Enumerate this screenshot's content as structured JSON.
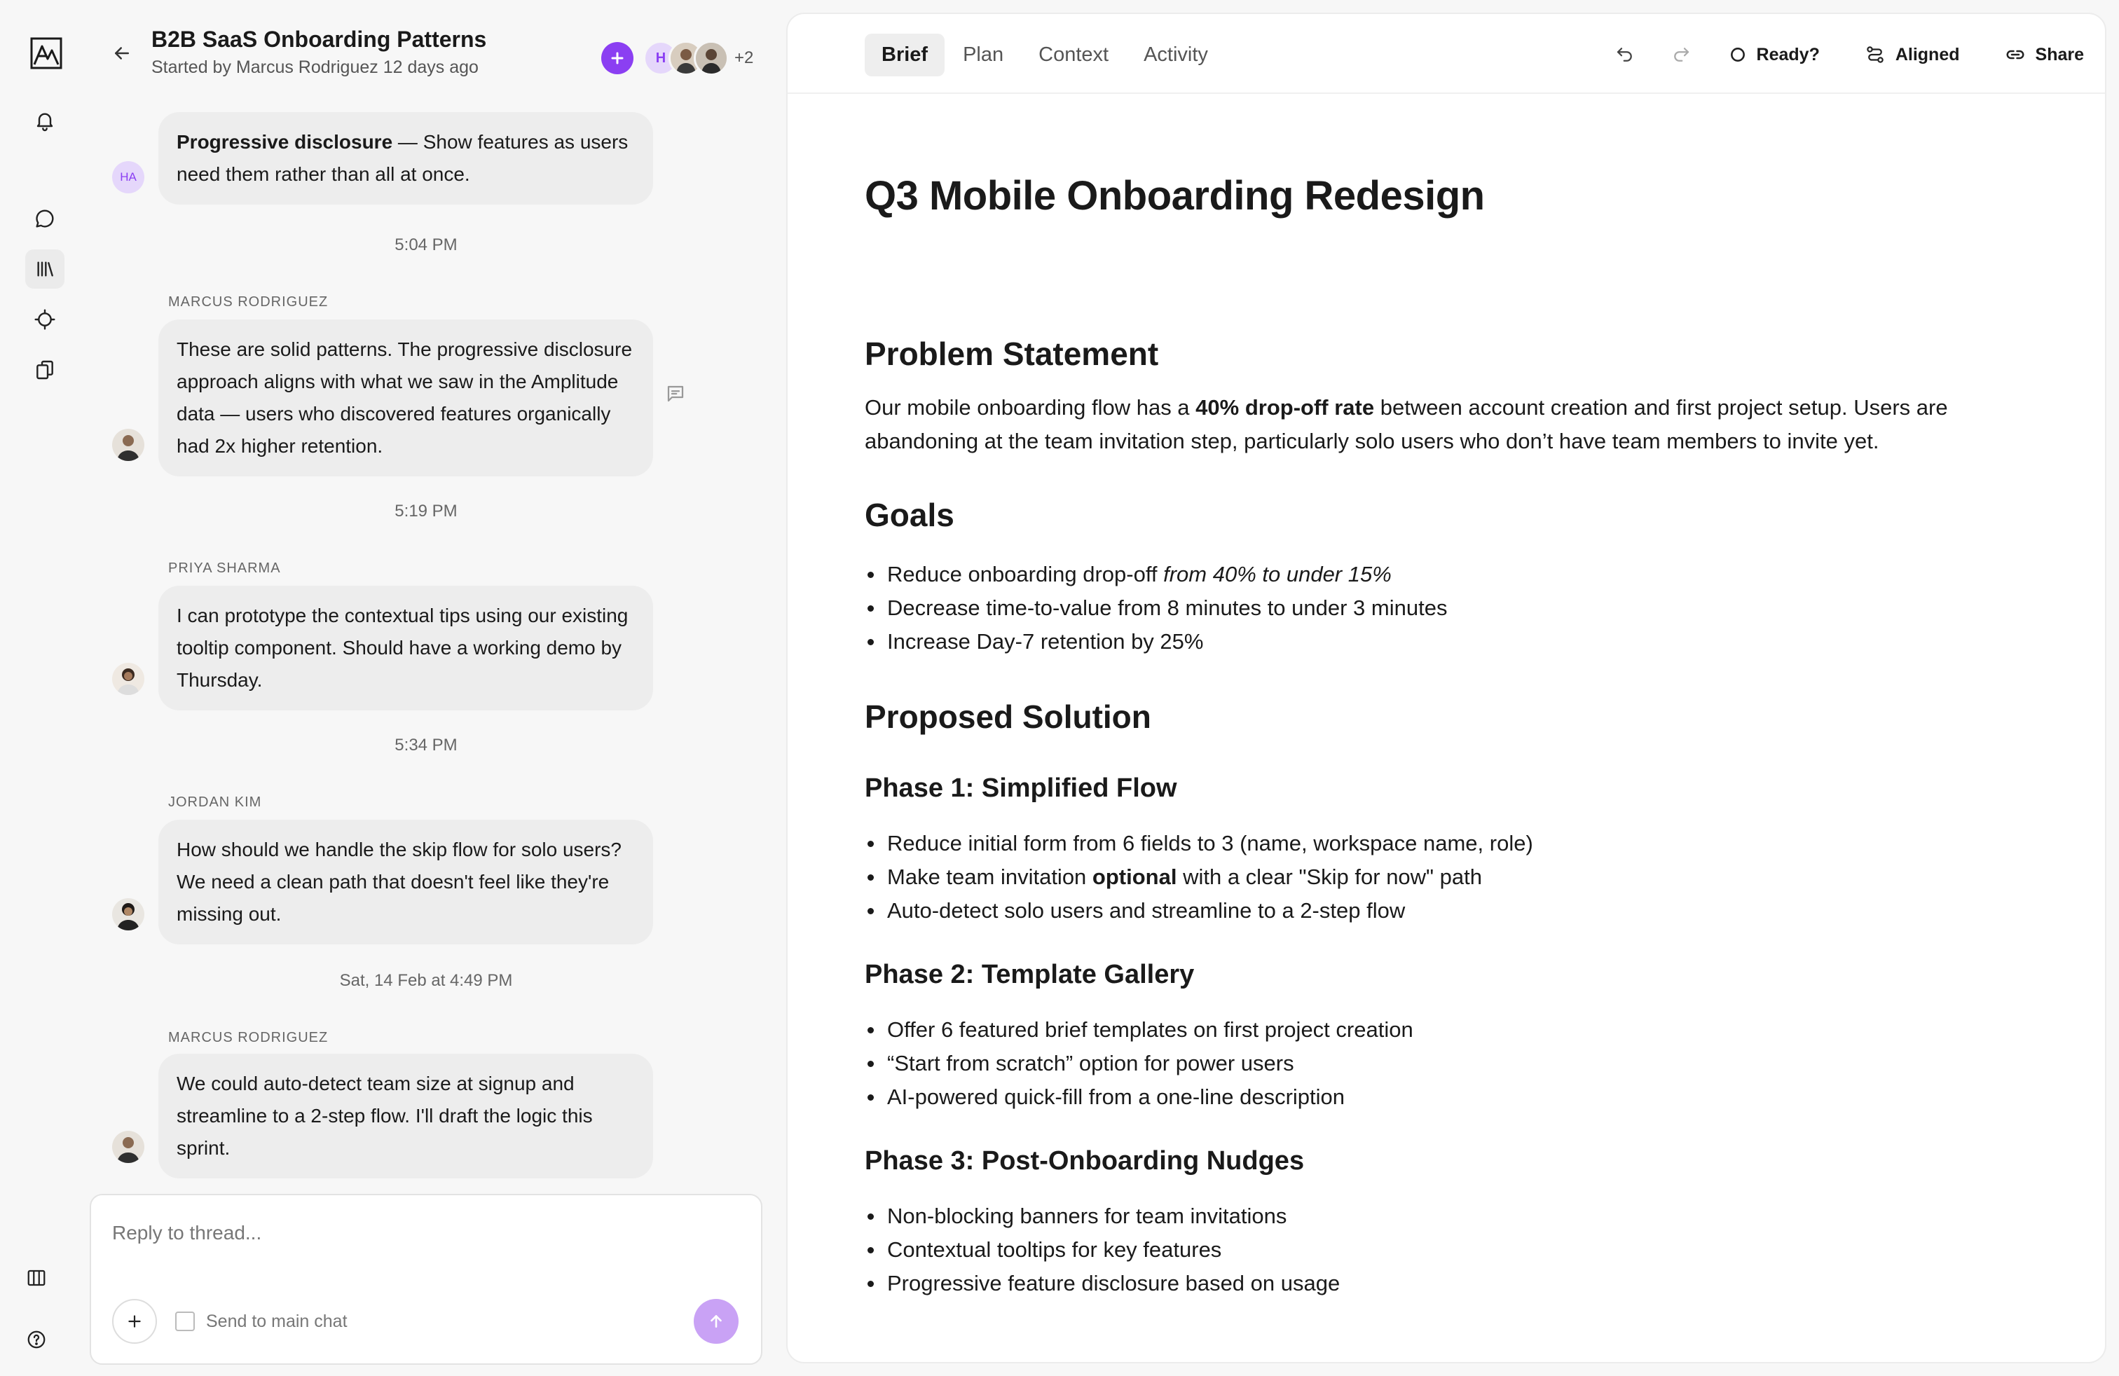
{
  "thread": {
    "title": "B2B SaaS Onboarding Patterns",
    "subtitle": "Started by Marcus Rodriguez 12 days ago",
    "avatar_initial": "H",
    "extra_members": "+2",
    "messages": [
      {
        "avatar_initials": "HA",
        "text_bold": "Progressive disclosure",
        "text_rest": " — Show features as users need them rather than all at once."
      },
      {
        "time": "5:04 PM",
        "author": "MARCUS RODRIGUEZ",
        "text": "These are solid patterns. The progressive disclosure approach aligns with what we saw in the Amplitude data — users who discovered features organically had 2x higher retention."
      },
      {
        "time": "5:19 PM",
        "author": "PRIYA SHARMA",
        "text": "I can prototype the contextual tips using our existing tooltip component. Should have a working demo by Thursday."
      },
      {
        "time": "5:34 PM",
        "author": "JORDAN KIM",
        "text": "How should we handle the skip flow for solo users? We need a clean path that doesn't feel like they're missing out."
      },
      {
        "time": "Sat, 14 Feb at 4:49 PM",
        "author": "MARCUS RODRIGUEZ",
        "text": "We could auto-detect team size at signup and streamline to a 2-step flow. I'll draft the logic this sprint."
      }
    ],
    "composer": {
      "placeholder": "Reply to thread...",
      "send_to_main_label": "Send to main chat"
    }
  },
  "brief": {
    "tabs": [
      {
        "label": "Brief",
        "active": true
      },
      {
        "label": "Plan",
        "active": false
      },
      {
        "label": "Context",
        "active": false
      },
      {
        "label": "Activity",
        "active": false
      }
    ],
    "toolbar": {
      "ready_label": "Ready?",
      "aligned_label": "Aligned",
      "share_label": "Share"
    },
    "title": "Q3 Mobile Onboarding Redesign",
    "problem": {
      "heading": "Problem Statement",
      "text_before": "Our mobile onboarding flow has a ",
      "text_bold": "40% drop-off rate",
      "text_after": " between account creation and first project setup. Users are abandoning at the team invitation step, particularly solo users who don’t have team members to invite yet."
    },
    "goals": {
      "heading": "Goals",
      "item1_before": "Reduce onboarding drop-off ",
      "item1_italic": "from 40% to under 15%",
      "item2": "Decrease time-to-value from 8 minutes to under 3 minutes",
      "item3": "Increase Day-7 retention by 25%"
    },
    "solution": {
      "heading": "Proposed Solution",
      "phase1": {
        "heading": "Phase 1: Simplified Flow",
        "item1": "Reduce initial form from 6 fields to 3 (name, workspace name, role)",
        "item2_before": "Make team invitation ",
        "item2_bold": "optional",
        "item2_after": " with a clear \"Skip for now\" path",
        "item3": "Auto-detect solo users and streamline to a 2-step flow"
      },
      "phase2": {
        "heading": "Phase 2: Template Gallery",
        "items": [
          "Offer 6 featured brief templates on first project creation",
          "“Start from scratch” option for power users",
          "AI-powered quick-fill from a one-line description"
        ]
      },
      "phase3": {
        "heading": "Phase 3: Post-Onboarding Nudges",
        "items": [
          "Non-blocking banners for team invitations",
          "Contextual tooltips for key features",
          "Progressive feature disclosure based on usage"
        ]
      }
    }
  },
  "colors": {
    "accent": "#8b3ff2",
    "send_button": "#c9a2f5",
    "bubble": "#ededed",
    "avatar_lavender": "#e5d7fb"
  }
}
